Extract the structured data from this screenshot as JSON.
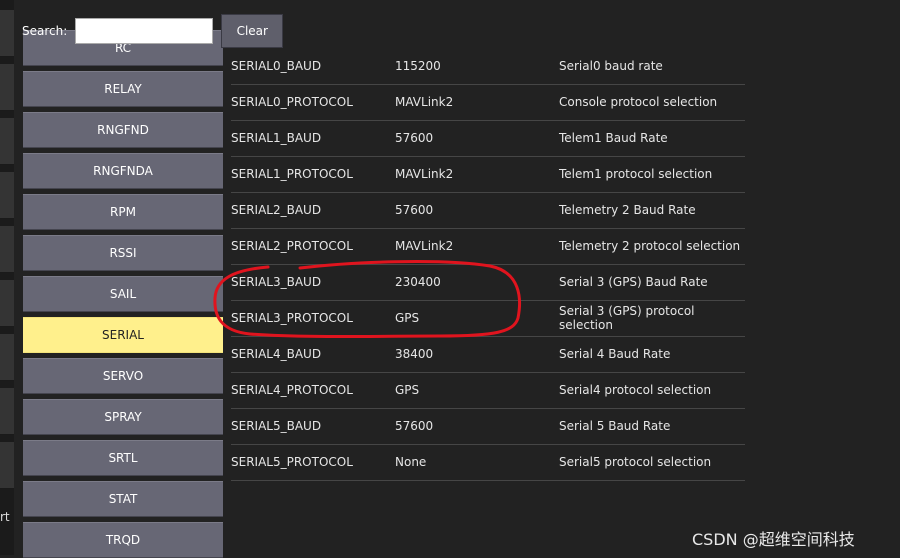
{
  "search": {
    "label": "Search:",
    "value": "",
    "placeholder": "",
    "clear_label": "Clear"
  },
  "left_strip": {
    "partial_text": "rt"
  },
  "categories": [
    {
      "label": "RC",
      "active": false
    },
    {
      "label": "RELAY",
      "active": false
    },
    {
      "label": "RNGFND",
      "active": false
    },
    {
      "label": "RNGFNDA",
      "active": false
    },
    {
      "label": "RPM",
      "active": false
    },
    {
      "label": "RSSI",
      "active": false
    },
    {
      "label": "SAIL",
      "active": false
    },
    {
      "label": "SERIAL",
      "active": true
    },
    {
      "label": "SERVO",
      "active": false
    },
    {
      "label": "SPRAY",
      "active": false
    },
    {
      "label": "SRTL",
      "active": false
    },
    {
      "label": "STAT",
      "active": false
    },
    {
      "label": "TRQD",
      "active": false
    }
  ],
  "params": [
    {
      "name": "SERIAL0_BAUD",
      "value": "115200",
      "desc": "Serial0 baud rate"
    },
    {
      "name": "SERIAL0_PROTOCOL",
      "value": "MAVLink2",
      "desc": "Console protocol selection"
    },
    {
      "name": "SERIAL1_BAUD",
      "value": "57600",
      "desc": "Telem1 Baud Rate"
    },
    {
      "name": "SERIAL1_PROTOCOL",
      "value": "MAVLink2",
      "desc": "Telem1 protocol selection"
    },
    {
      "name": "SERIAL2_BAUD",
      "value": "57600",
      "desc": "Telemetry 2 Baud Rate"
    },
    {
      "name": "SERIAL2_PROTOCOL",
      "value": "MAVLink2",
      "desc": "Telemetry 2 protocol selection"
    },
    {
      "name": "SERIAL3_BAUD",
      "value": "230400",
      "desc": "Serial 3 (GPS) Baud Rate"
    },
    {
      "name": "SERIAL3_PROTOCOL",
      "value": "GPS",
      "desc": "Serial 3 (GPS) protocol selection"
    },
    {
      "name": "SERIAL4_BAUD",
      "value": "38400",
      "desc": "Serial 4 Baud Rate"
    },
    {
      "name": "SERIAL4_PROTOCOL",
      "value": "GPS",
      "desc": "Serial4 protocol selection"
    },
    {
      "name": "SERIAL5_BAUD",
      "value": "57600",
      "desc": "Serial 5 Baud Rate"
    },
    {
      "name": "SERIAL5_PROTOCOL",
      "value": "None",
      "desc": "Serial5 protocol selection"
    }
  ],
  "watermark": "CSDN @超维空间科技",
  "colors": {
    "background": "#222222",
    "category_button": "#676775",
    "category_active": "#fff08c",
    "annotation": "#e0141e"
  }
}
